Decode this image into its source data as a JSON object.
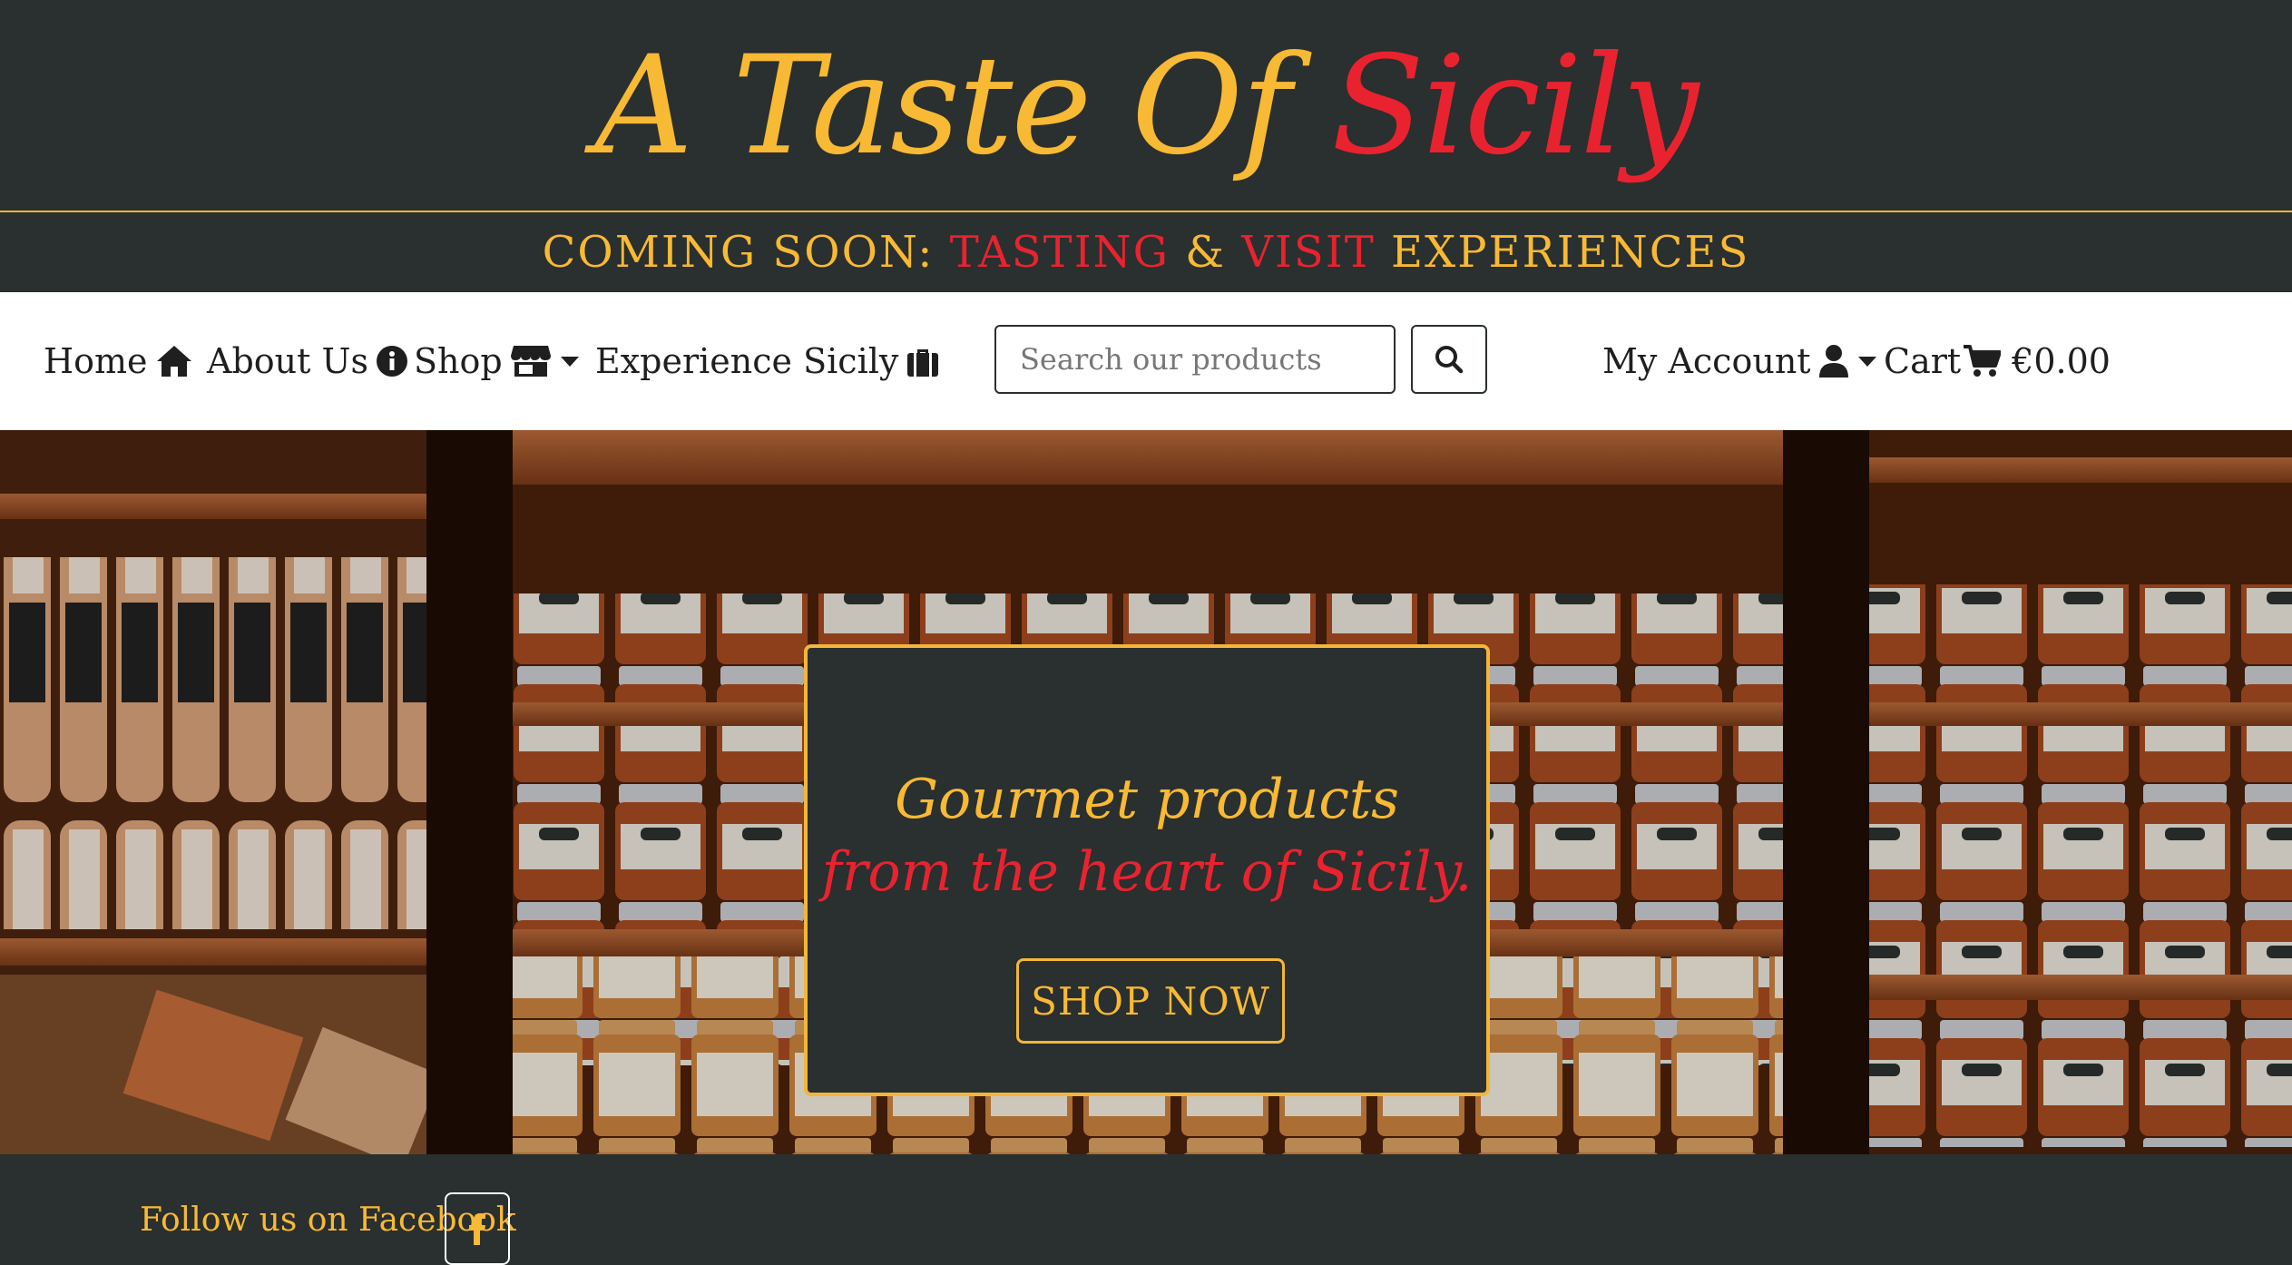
{
  "brand": {
    "part1": "A Taste Of",
    "part2": "Sicily"
  },
  "banner": {
    "prefix": "COMING SOON:",
    "tasting": "TASTING",
    "amp": "&",
    "visit": "VISIT",
    "experiences": "EXPERIENCES"
  },
  "nav": {
    "home": "Home",
    "about": "About Us",
    "shop": "Shop",
    "experience": "Experience Sicily",
    "account": "My Account",
    "cart": "Cart",
    "cart_total": "€0.00"
  },
  "search": {
    "placeholder": "Search our products"
  },
  "hero": {
    "line1": "Gourmet products",
    "line2": "from the heart of Sicily.",
    "button": "SHOP NOW"
  },
  "footer": {
    "follow": "Follow us on Facebook"
  },
  "colors": {
    "dark": "#2a2f2f",
    "gold": "#f8b934",
    "red": "#e8232f"
  },
  "icons": {
    "home": "home-icon",
    "about": "info-icon",
    "shop": "store-icon",
    "experience": "suitcase-icon",
    "search": "search-icon",
    "account": "user-icon",
    "cart": "cart-icon",
    "facebook": "facebook-icon"
  }
}
